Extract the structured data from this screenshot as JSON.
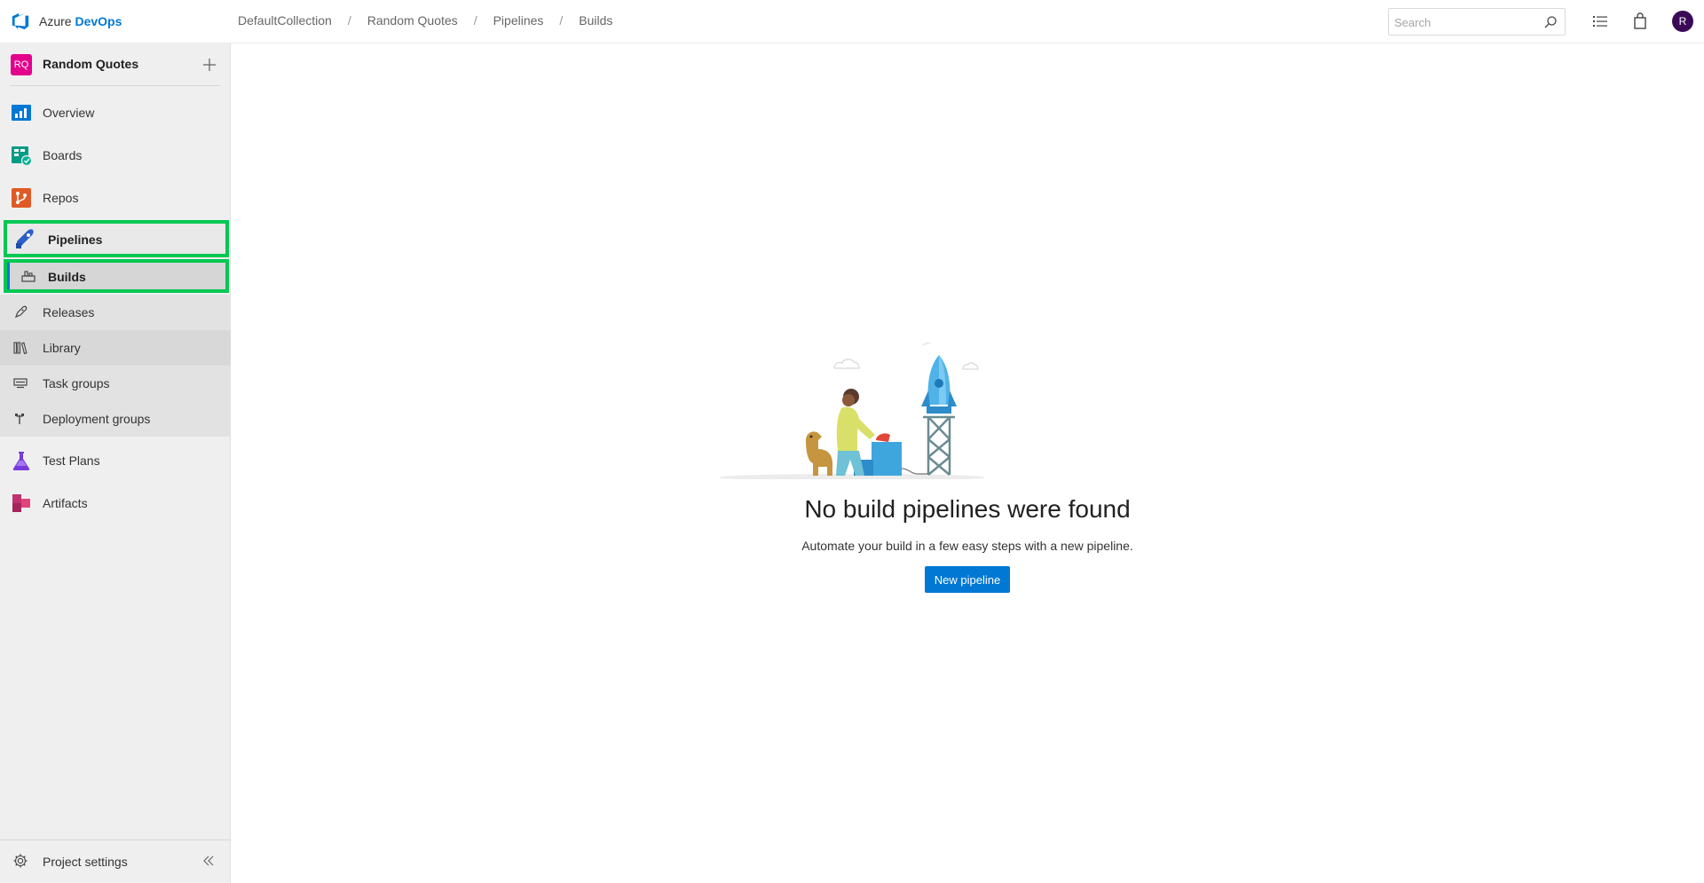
{
  "app": {
    "brand_prefix": "Azure",
    "brand_suffix": "DevOps"
  },
  "breadcrumb": [
    "DefaultCollection",
    "Random Quotes",
    "Pipelines",
    "Builds"
  ],
  "search": {
    "placeholder": "Search"
  },
  "user": {
    "initial": "R"
  },
  "project": {
    "badge": "RQ",
    "name": "Random Quotes"
  },
  "nav": {
    "overview": "Overview",
    "boards": "Boards",
    "repos": "Repos",
    "pipelines": "Pipelines",
    "builds": "Builds",
    "releases": "Releases",
    "library": "Library",
    "task_groups": "Task groups",
    "deployment_groups": "Deployment groups",
    "test_plans": "Test Plans",
    "artifacts": "Artifacts",
    "project_settings": "Project settings"
  },
  "empty_state": {
    "title": "No build pipelines were found",
    "subtitle": "Automate your build in a few easy steps with a new pipeline.",
    "button": "New pipeline"
  },
  "colors": {
    "accent": "#0078d4",
    "highlight": "#00c853",
    "project_badge": "#e3008c",
    "avatar": "#3b0a57"
  }
}
